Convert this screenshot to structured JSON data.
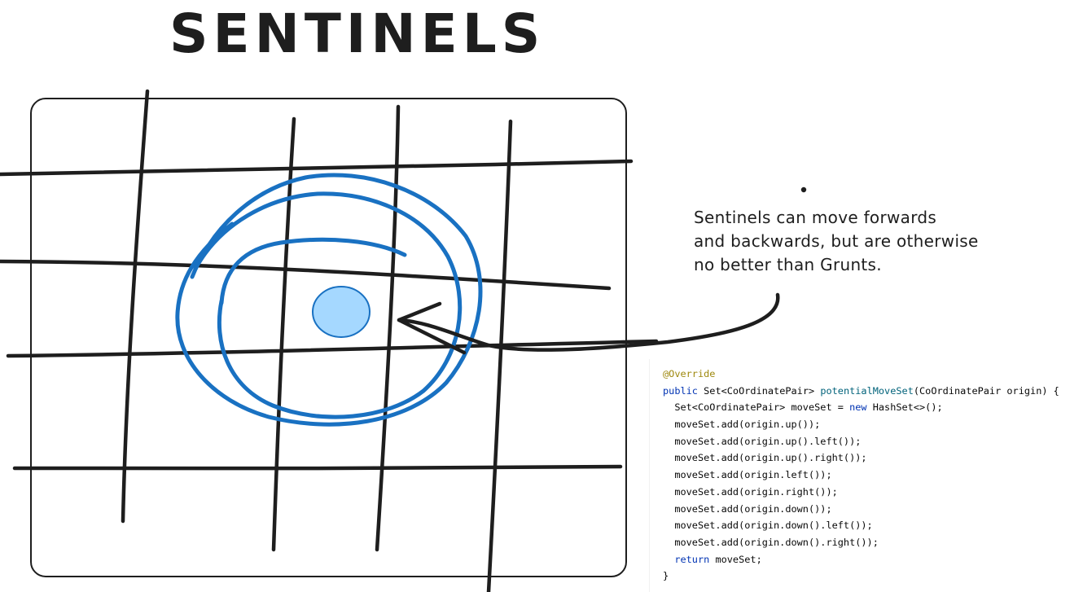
{
  "title": "SENTINELS",
  "annotation": {
    "lines": [
      "Sentinels can move forwards",
      "and backwards, but are otherwise",
      "no better than Grunts."
    ]
  },
  "colors": {
    "ink": "#1e1e1e",
    "circle_stroke": "#1971c2",
    "piece_fill": "#a5d8ff"
  },
  "code": {
    "lines": [
      [
        {
          "t": "@Override",
          "k": "ann"
        }
      ],
      [
        {
          "t": "public ",
          "k": "kw"
        },
        {
          "t": "Set<CoOrdinatePair> ",
          "k": "plain"
        },
        {
          "t": "potentialMoveSet",
          "k": "fn"
        },
        {
          "t": "(CoOrdinatePair origin) {",
          "k": "plain"
        }
      ],
      [
        {
          "t": "  Set<CoOrdinatePair> moveSet = ",
          "k": "plain"
        },
        {
          "t": "new ",
          "k": "kw"
        },
        {
          "t": "HashSet<>();",
          "k": "plain"
        }
      ],
      [
        {
          "t": "  moveSet.add(origin.up());",
          "k": "plain"
        }
      ],
      [
        {
          "t": "  moveSet.add(origin.up().left());",
          "k": "plain"
        }
      ],
      [
        {
          "t": "  moveSet.add(origin.up().right());",
          "k": "plain"
        }
      ],
      [
        {
          "t": "  moveSet.add(origin.left());",
          "k": "plain"
        }
      ],
      [
        {
          "t": "  moveSet.add(origin.right());",
          "k": "plain"
        }
      ],
      [
        {
          "t": "  moveSet.add(origin.down());",
          "k": "plain"
        }
      ],
      [
        {
          "t": "  moveSet.add(origin.down().left());",
          "k": "plain"
        }
      ],
      [
        {
          "t": "  moveSet.add(origin.down().right());",
          "k": "plain"
        }
      ],
      [
        {
          "t": "  ",
          "k": "plain"
        },
        {
          "t": "return ",
          "k": "kw"
        },
        {
          "t": "moveSet;",
          "k": "plain"
        }
      ],
      [
        {
          "t": "}",
          "k": "plain"
        }
      ]
    ]
  }
}
